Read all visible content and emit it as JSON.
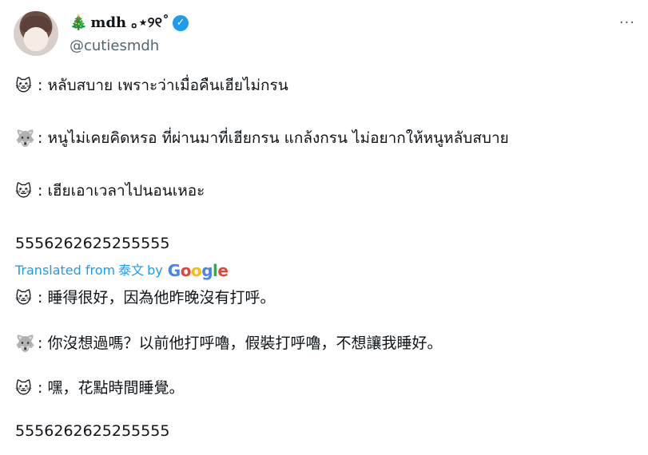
{
  "author": {
    "name_emoji": "🎄",
    "display_name": "mdh ｡⋆୨୧˚",
    "verified_glyph": "✓",
    "handle": "@cutiesmdh",
    "more_glyph": "···"
  },
  "tweet": {
    "lines": [
      {
        "emoji": "🐱",
        "text": ": หลับสบาย เพราะว่าเมื่อคืนเฮียไม่กรน"
      },
      {
        "emoji": "🐺",
        "text": ": หนูไม่เคยคิดหรอ ที่ผ่านมาที่เฮียกรน แกล้งกรน ไม่อยากให้หนูหลับสบาย"
      },
      {
        "emoji": "🐱",
        "text": ": เฮียเอาเวลาไปนอนเหอะ"
      }
    ],
    "trailing": "5556262625255555"
  },
  "translation": {
    "label": "Translated from",
    "language": "泰文",
    "by": "by",
    "provider": "Google",
    "lines": [
      {
        "emoji": "🐱",
        "text": " : 睡得很好，因為他昨晚沒有打呼。"
      },
      {
        "emoji": "🐺",
        "text": " : 你沒想過嗎？以前他打呼嚕，假裝打呼嚕，不想讓我睡好。"
      },
      {
        "emoji": "🐱",
        "text": " : 嘿，花點時間睡覺。"
      }
    ],
    "trailing": "5556262625255555"
  }
}
